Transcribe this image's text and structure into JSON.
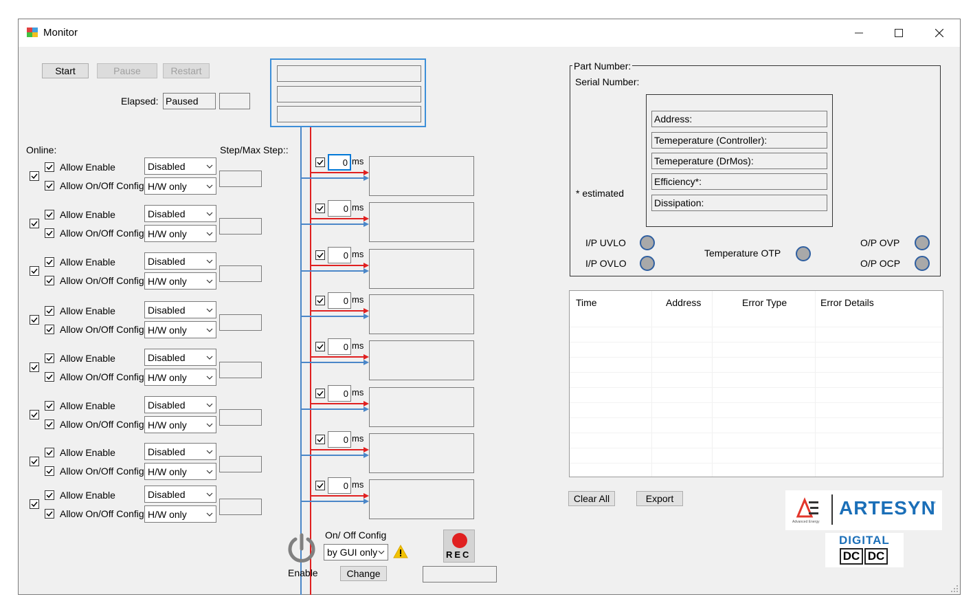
{
  "window": {
    "title": "Monitor"
  },
  "controls": {
    "start": "Start",
    "pause": "Pause",
    "restart": "Restart"
  },
  "elapsed": {
    "label": "Elapsed:",
    "value": "Paused"
  },
  "online_label": "Online:",
  "step_label": "Step/Max Step::",
  "rail_rows": [
    {
      "enable_label": "Allow Enable",
      "enable_value": "Disabled",
      "onoff_label": "Allow On/Off Config",
      "onoff_value": "H/W only"
    },
    {
      "enable_label": "Allow Enable",
      "enable_value": "Disabled",
      "onoff_label": "Allow On/Off Config",
      "onoff_value": "H/W only"
    },
    {
      "enable_label": "Allow Enable",
      "enable_value": "Disabled",
      "onoff_label": "Allow On/Off Config",
      "onoff_value": "H/W only"
    },
    {
      "enable_label": "Allow Enable",
      "enable_value": "Disabled",
      "onoff_label": "Allow On/Off Config",
      "onoff_value": "H/W only"
    },
    {
      "enable_label": "Allow Enable",
      "enable_value": "Disabled",
      "onoff_label": "Allow On/Off Config",
      "onoff_value": "H/W only"
    },
    {
      "enable_label": "Allow Enable",
      "enable_value": "Disabled",
      "onoff_label": "Allow On/Off Config",
      "onoff_value": "H/W only"
    },
    {
      "enable_label": "Allow Enable",
      "enable_value": "Disabled",
      "onoff_label": "Allow On/Off Config",
      "onoff_value": "H/W only"
    },
    {
      "enable_label": "Allow Enable",
      "enable_value": "Disabled",
      "onoff_label": "Allow On/Off Config",
      "onoff_value": "H/W only"
    }
  ],
  "delays": [
    {
      "value": "0",
      "unit": "ms"
    },
    {
      "value": "0",
      "unit": "ms"
    },
    {
      "value": "0",
      "unit": "ms"
    },
    {
      "value": "0",
      "unit": "ms"
    },
    {
      "value": "0",
      "unit": "ms"
    },
    {
      "value": "0",
      "unit": "ms"
    },
    {
      "value": "0",
      "unit": "ms"
    },
    {
      "value": "0",
      "unit": "ms"
    }
  ],
  "enable_label": "Enable",
  "onoff_config": {
    "label": "On/ Off Config",
    "value": "by GUI only",
    "change": "Change"
  },
  "rec_label": "REC",
  "info": {
    "part_number": "Part Number:",
    "serial_number": "Serial Number:",
    "estimated": "* estimated",
    "fields": [
      "Address:",
      "Temeperature (Controller):",
      "Temeperature (DrMos):",
      "Efficiency*:",
      "Dissipation:"
    ]
  },
  "faults": {
    "ip_uvlo": "I/P UVLO",
    "ip_ovlo": "I/P OVLO",
    "temp_otp": "Temperature OTP",
    "op_ovp": "O/P OVP",
    "op_ocp": "O/P OCP"
  },
  "errors_table": {
    "columns": [
      "Time",
      "Address",
      "Error Type",
      "Error Details"
    ]
  },
  "buttons": {
    "clear_all": "Clear All",
    "export": "Export"
  },
  "branding": {
    "company": "ARTESYN",
    "tm": "™",
    "sub": "Advanced Energy",
    "digital": "DIGITAL",
    "dc": "DC"
  },
  "colors": {
    "blue_line": "#4a86c8",
    "red_line": "#e02020",
    "accent": "#0078d7"
  }
}
